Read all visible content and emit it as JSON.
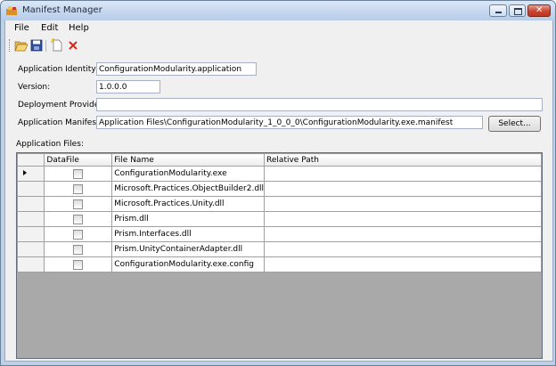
{
  "window": {
    "title": "Manifest Manager"
  },
  "menu": {
    "file": "File",
    "edit": "Edit",
    "help": "Help"
  },
  "toolbar": {
    "open_icon": "open-folder-icon",
    "save_icon": "save-icon",
    "new_icon": "new-file-icon",
    "delete_icon": "delete-icon"
  },
  "form": {
    "identity_label": "Application Identity:",
    "identity_value": "ConfigurationModularity.application",
    "version_label": "Version:",
    "version_value": "1.0.0.0",
    "provider_label": "Deployment Provider:",
    "provider_value": "",
    "manifest_label": "Application Manifest:",
    "manifest_value": "Application Files\\ConfigurationModularity_1_0_0_0\\ConfigurationModularity.exe.manifest",
    "select_button": "Select...",
    "files_label": "Application Files:"
  },
  "grid": {
    "columns": {
      "datafile": "DataFile",
      "filename": "File Name",
      "relpath": "Relative Path"
    },
    "rows": [
      {
        "file": "ConfigurationModularity.exe",
        "path": "",
        "datafile": false
      },
      {
        "file": "Microsoft.Practices.ObjectBuilder2.dll",
        "path": "",
        "datafile": false
      },
      {
        "file": "Microsoft.Practices.Unity.dll",
        "path": "",
        "datafile": false
      },
      {
        "file": "Prism.dll",
        "path": "",
        "datafile": false
      },
      {
        "file": "Prism.Interfaces.dll",
        "path": "",
        "datafile": false
      },
      {
        "file": "Prism.UnityContainerAdapter.dll",
        "path": "",
        "datafile": false
      },
      {
        "file": "ConfigurationModularity.exe.config",
        "path": "",
        "datafile": false
      }
    ]
  }
}
